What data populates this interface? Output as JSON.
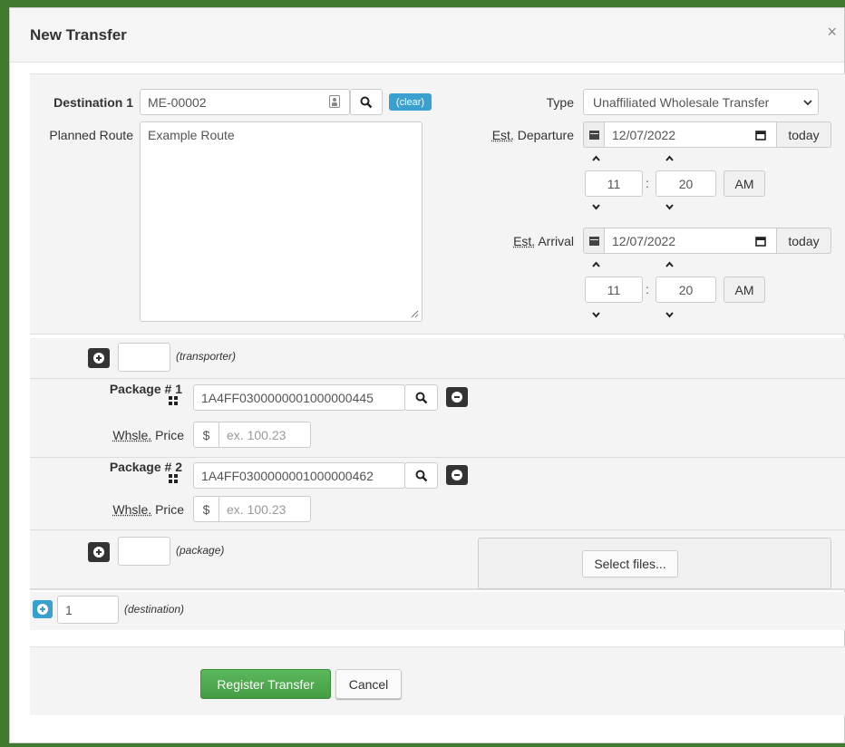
{
  "modal": {
    "title": "New Transfer",
    "close_glyph": "×"
  },
  "destination": {
    "label": "Destination 1",
    "value": "ME-00002",
    "clear_label": "(clear)",
    "route_label": "Planned Route",
    "route_value": "Example Route"
  },
  "type": {
    "label": "Type",
    "value": "Unaffiliated Wholesale Transfer"
  },
  "departure": {
    "label_abbr": "Est.",
    "label_rest": " Departure",
    "date": "12/07/2022",
    "today_label": "today",
    "hour": "11",
    "minute": "20",
    "ampm": "AM",
    "sep": ":"
  },
  "arrival": {
    "label_abbr": "Est.",
    "label_rest": " Arrival",
    "date": "12/07/2022",
    "today_label": "today",
    "hour": "11",
    "minute": "20",
    "ampm": "AM",
    "sep": ":"
  },
  "transporter": {
    "count": "",
    "label": "(transporter)"
  },
  "packages": [
    {
      "label": "Package # 1",
      "tag": "1A4FF0300000001000000445",
      "price_label_abbr": "Whsle.",
      "price_label_rest": " Price",
      "currency": "$",
      "price_placeholder": "ex. 100.23"
    },
    {
      "label": "Package # 2",
      "tag": "1A4FF0300000001000000462",
      "price_label_abbr": "Whsle.",
      "price_label_rest": " Price",
      "currency": "$",
      "price_placeholder": "ex. 100.23"
    }
  ],
  "add_package": {
    "count": "",
    "label": "(package)"
  },
  "files": {
    "button": "Select files..."
  },
  "add_destination": {
    "count": "1",
    "label": "(destination)"
  },
  "footer": {
    "register_label": "Register Transfer",
    "cancel_label": "Cancel"
  }
}
